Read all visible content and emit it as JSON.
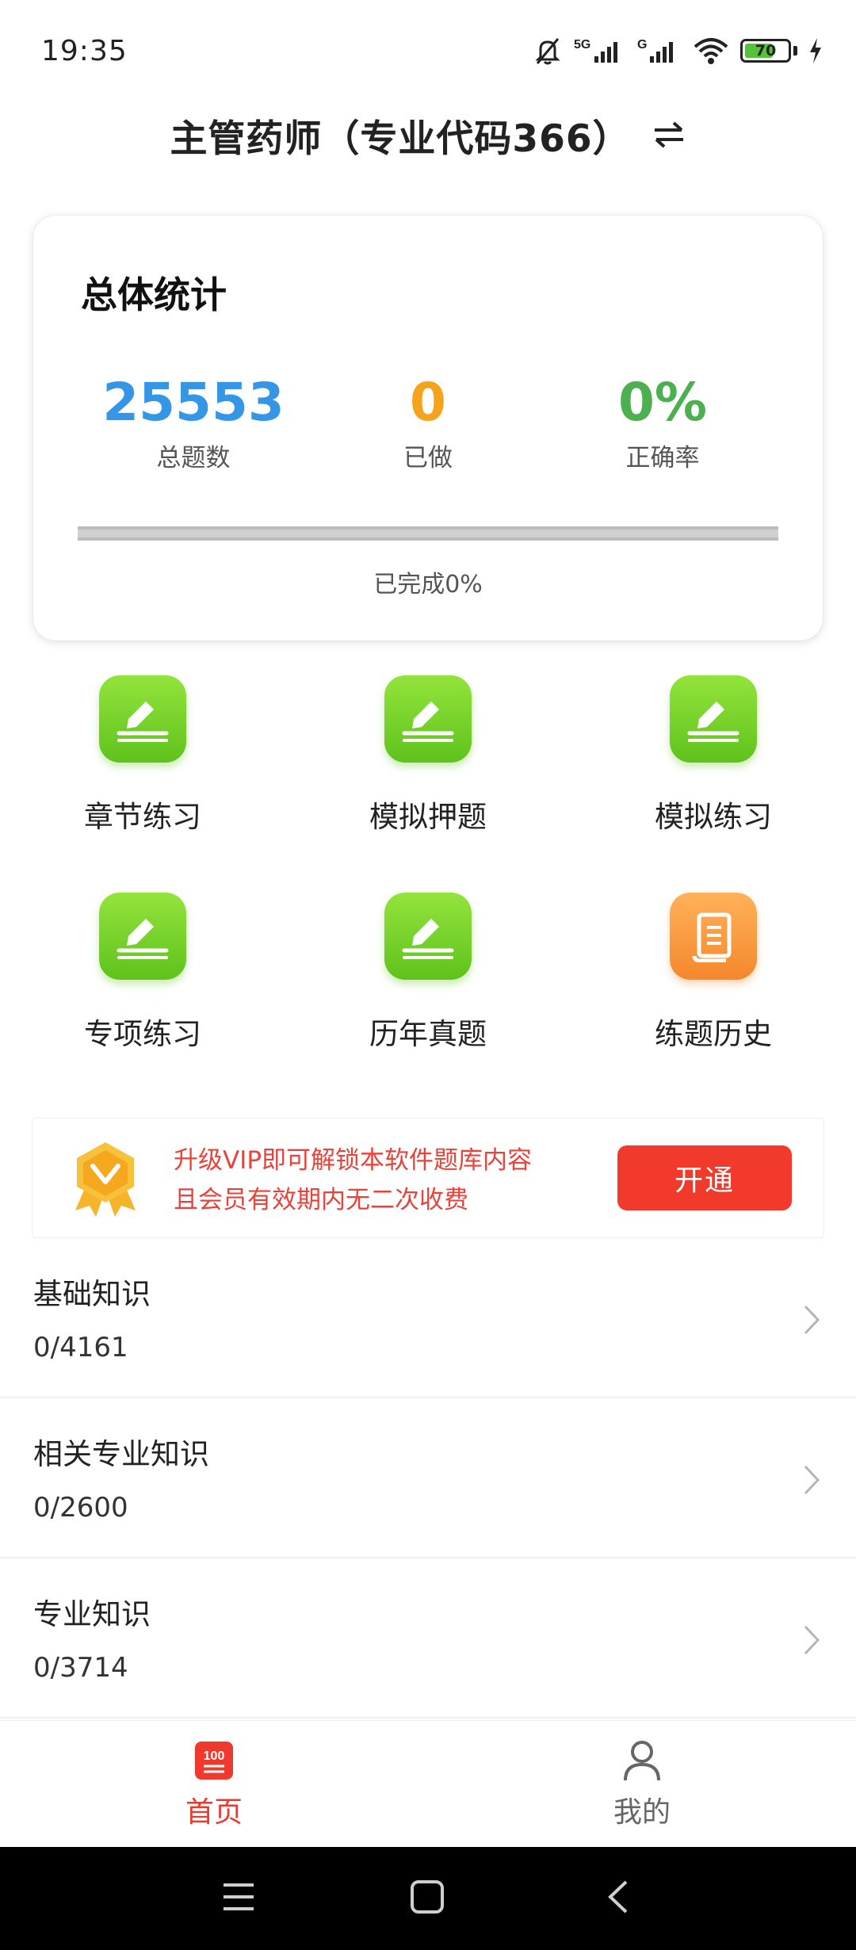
{
  "status_bar": {
    "time": "19:35",
    "battery_level": "70",
    "icons": [
      "mute-bell-icon",
      "5g-signal-icon",
      "g-signal-icon",
      "wifi-icon",
      "battery-icon",
      "charging-icon"
    ]
  },
  "header": {
    "title": "主管药师（专业代码366）",
    "switch_icon": "swap-arrows-icon"
  },
  "stats": {
    "title": "总体统计",
    "items": [
      {
        "value": "25553",
        "label": "总题数",
        "color": "#3596e6"
      },
      {
        "value": "0",
        "label": "已做",
        "color": "#f5a21c"
      },
      {
        "value": "0%",
        "label": "正确率",
        "color": "#4caf50"
      }
    ],
    "progress_fraction": 0,
    "progress_text": "已完成0%"
  },
  "functions": [
    {
      "label": "章节练习",
      "icon": "edit-pen-icon",
      "color": "green"
    },
    {
      "label": "模拟押题",
      "icon": "edit-pen-icon",
      "color": "green"
    },
    {
      "label": "模拟练习",
      "icon": "edit-pen-icon",
      "color": "green"
    },
    {
      "label": "专项练习",
      "icon": "edit-pen-icon",
      "color": "green"
    },
    {
      "label": "历年真题",
      "icon": "edit-pen-icon",
      "color": "green"
    },
    {
      "label": "练题历史",
      "icon": "scroll-history-icon",
      "color": "orange"
    }
  ],
  "vip": {
    "line1": "升级VIP即可解锁本软件题库内容",
    "line2": "且会员有效期内无二次收费",
    "button": "开通"
  },
  "subjects": [
    {
      "title": "基础知识",
      "count": "0/4161"
    },
    {
      "title": "相关专业知识",
      "count": "0/2600"
    },
    {
      "title": "专业知识",
      "count": "0/3714"
    }
  ],
  "bottom_nav": {
    "home_label": "首页",
    "home_badge": "100",
    "mine_label": "我的"
  },
  "colors": {
    "accent_red": "#f0382c",
    "green_icon": "#6fcf2a",
    "orange_icon": "#f7902f"
  }
}
